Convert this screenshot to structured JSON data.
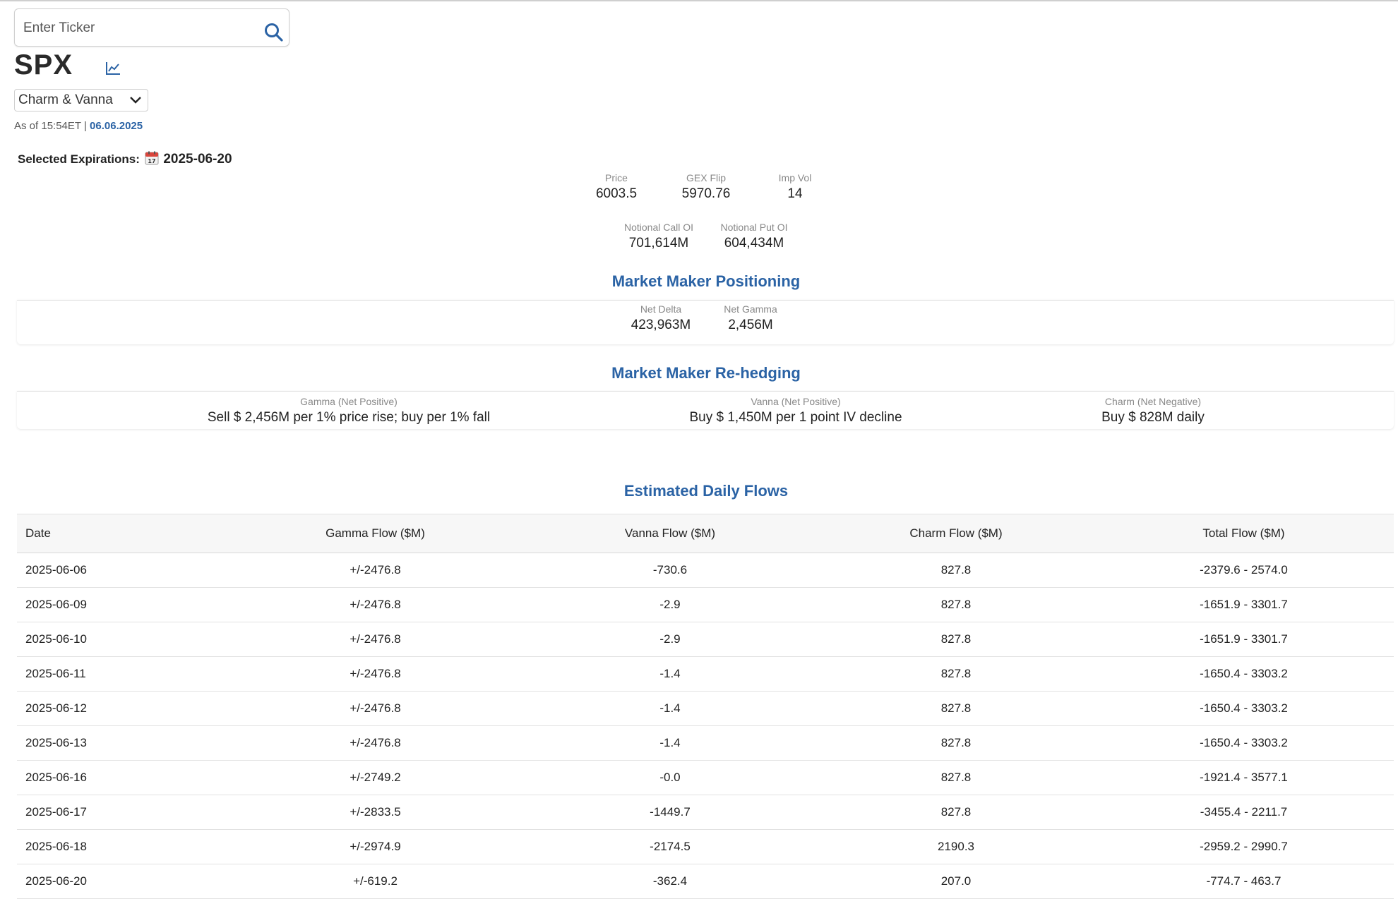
{
  "search": {
    "placeholder": "Enter Ticker",
    "icon": "search-icon"
  },
  "ticker": "SPX",
  "chart_icon": "line-chart-icon",
  "view_select": {
    "selected": "Charm & Vanna"
  },
  "as_of": {
    "prefix": "As of 15:54ET |",
    "date": "06.06.2025"
  },
  "selected_expirations": {
    "label": "Selected Expirations:",
    "value": "2025-06-20",
    "icon": "calendar-icon"
  },
  "stats": {
    "price": {
      "label": "Price",
      "value": "6003.5"
    },
    "gex_flip": {
      "label": "GEX Flip",
      "value": "5970.76"
    },
    "imp_vol": {
      "label": "Imp Vol",
      "value": "14"
    },
    "notional_call_oi": {
      "label": "Notional Call OI",
      "value": "701,614M"
    },
    "notional_put_oi": {
      "label": "Notional Put OI",
      "value": "604,434M"
    }
  },
  "positioning": {
    "title": "Market Maker Positioning",
    "net_delta": {
      "label": "Net Delta",
      "value": "423,963M"
    },
    "net_gamma": {
      "label": "Net Gamma",
      "value": "2,456M"
    }
  },
  "rehedging": {
    "title": "Market Maker Re-hedging",
    "gamma": {
      "label": "Gamma (Net Positive)",
      "value": "Sell $ 2,456M per 1% price rise; buy per 1% fall"
    },
    "vanna": {
      "label": "Vanna (Net Positive)",
      "value": "Buy $ 1,450M per 1 point IV decline"
    },
    "charm": {
      "label": "Charm (Net Negative)",
      "value": "Buy $ 828M daily"
    }
  },
  "flows": {
    "title": "Estimated Daily Flows",
    "columns": [
      "Date",
      "Gamma Flow ($M)",
      "Vanna Flow ($M)",
      "Charm Flow ($M)",
      "Total Flow ($M)"
    ],
    "rows": [
      [
        "2025-06-06",
        "+/-2476.8",
        "-730.6",
        "827.8",
        "-2379.6 - 2574.0"
      ],
      [
        "2025-06-09",
        "+/-2476.8",
        "-2.9",
        "827.8",
        "-1651.9 - 3301.7"
      ],
      [
        "2025-06-10",
        "+/-2476.8",
        "-2.9",
        "827.8",
        "-1651.9 - 3301.7"
      ],
      [
        "2025-06-11",
        "+/-2476.8",
        "-1.4",
        "827.8",
        "-1650.4 - 3303.2"
      ],
      [
        "2025-06-12",
        "+/-2476.8",
        "-1.4",
        "827.8",
        "-1650.4 - 3303.2"
      ],
      [
        "2025-06-13",
        "+/-2476.8",
        "-1.4",
        "827.8",
        "-1650.4 - 3303.2"
      ],
      [
        "2025-06-16",
        "+/-2749.2",
        "-0.0",
        "827.8",
        "-1921.4 - 3577.1"
      ],
      [
        "2025-06-17",
        "+/-2833.5",
        "-1449.7",
        "827.8",
        "-3455.4 - 2211.7"
      ],
      [
        "2025-06-18",
        "+/-2974.9",
        "-2174.5",
        "2190.3",
        "-2959.2 - 2990.7"
      ],
      [
        "2025-06-20",
        "+/-619.2",
        "-362.4",
        "207.0",
        "-774.7 - 463.7"
      ]
    ]
  },
  "colors": {
    "accent": "#2b63a5",
    "label_gray": "#888888",
    "text": "#222222"
  }
}
